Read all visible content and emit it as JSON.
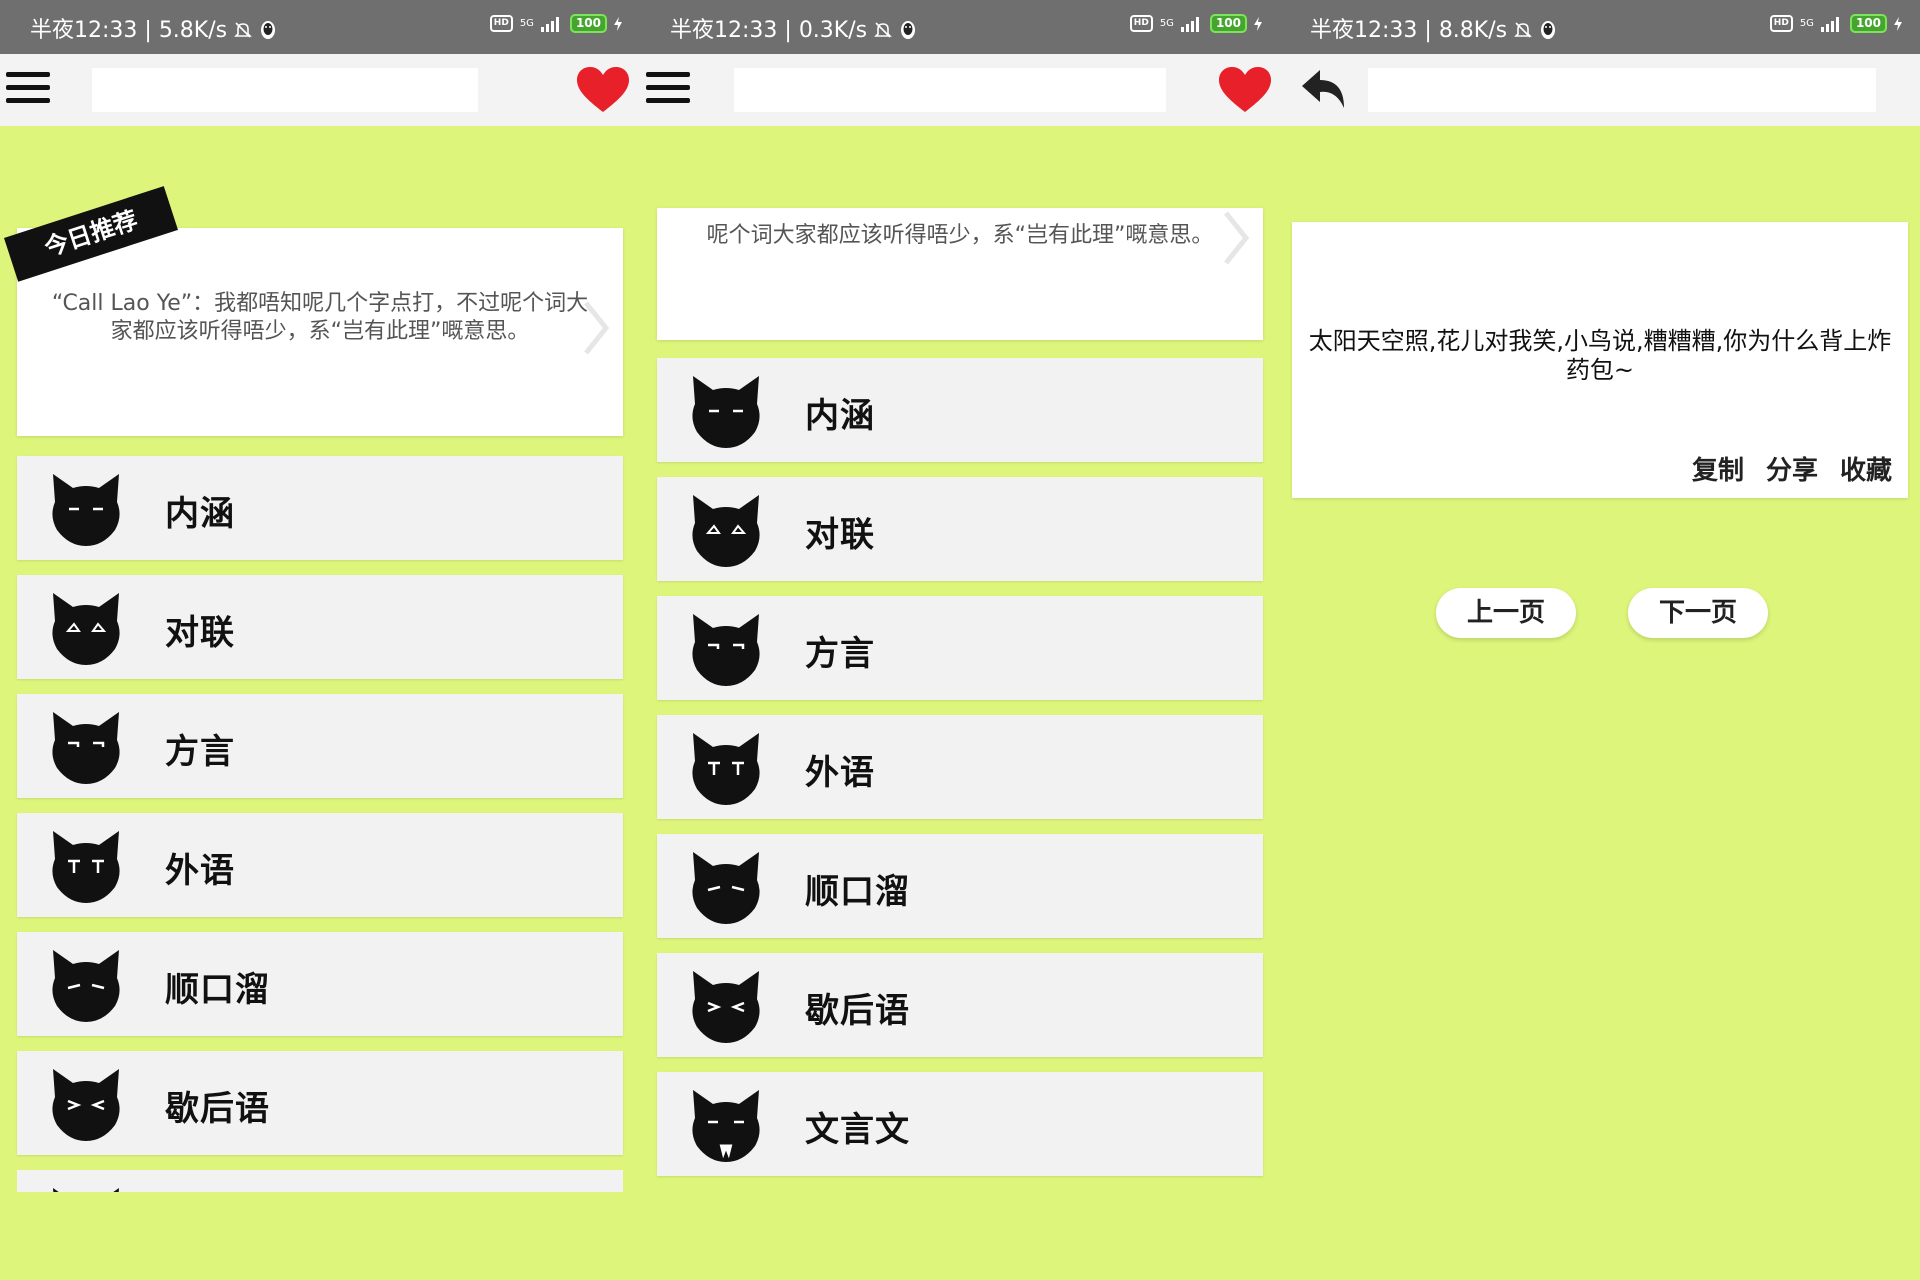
{
  "status_bars": [
    {
      "time": "半夜12:33",
      "speed": "5.8K/s",
      "network": "5G",
      "battery": "100"
    },
    {
      "time": "半夜12:33",
      "speed": "0.3K/s",
      "network": "5G",
      "battery": "100"
    },
    {
      "time": "半夜12:33",
      "speed": "8.8K/s",
      "network": "5G",
      "battery": "100"
    }
  ],
  "status_icons": {
    "hd": "HD"
  },
  "icons": [
    "menu-icon",
    "heart-icon",
    "back-arrow-icon",
    "chevron-right-icon",
    "cat-face-icon",
    "mute-icon",
    "qq-icon"
  ],
  "colors": {
    "background": "#dcf57a",
    "toolbar": "#f3f3f3",
    "statusbar": "#6f6f6f",
    "heart": "#e8202a",
    "list_item": "#f2f2f2"
  },
  "search": {
    "placeholder": ""
  },
  "recommend": {
    "ribbon": "今日推荐",
    "text": "“Call Lao Ye”：我都唔知呢几个字点打，不过呢个词大家都应该听得唔少，系“岂有此理”嘅意思。",
    "text_partial": "呢个词大家都应该听得唔少，系“岂有此理”嘅意思。"
  },
  "categories": [
    "内涵",
    "对联",
    "方言",
    "外语",
    "顺口溜",
    "歇后语",
    "文言文"
  ],
  "detail": {
    "joke": "太阳天空照,花儿对我笑,小鸟说,糟糟糟,你为什么背上炸药包~",
    "actions": {
      "copy": "复制",
      "share": "分享",
      "favorite": "收藏"
    },
    "prev": "上一页",
    "next": "下一页"
  }
}
